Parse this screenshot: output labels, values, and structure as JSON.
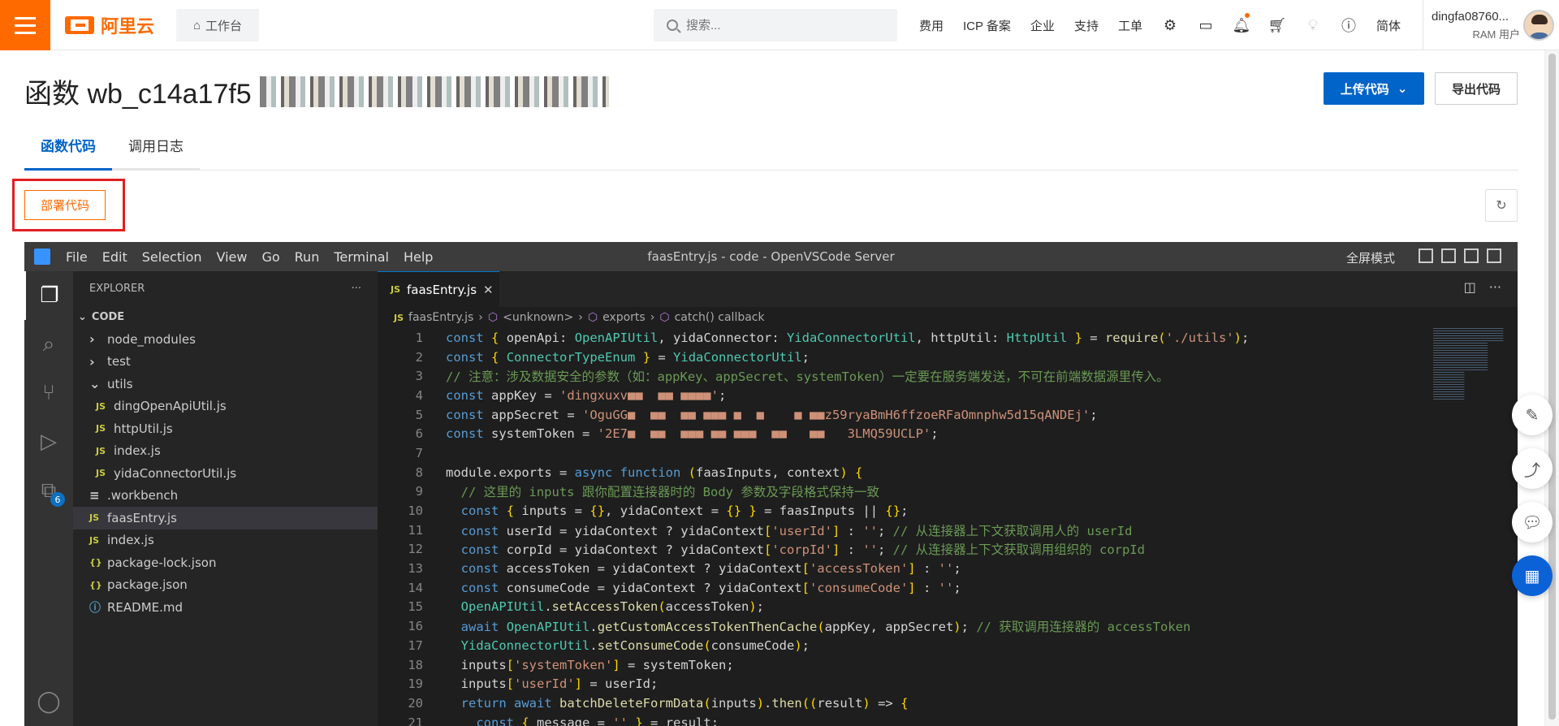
{
  "topbar": {
    "brand": "阿里云",
    "workbench": "工作台",
    "search_placeholder": "搜索...",
    "links": [
      "费用",
      "ICP 备案",
      "企业",
      "支持",
      "工单"
    ],
    "lang": "简体",
    "user_name": "dingfa08760...",
    "user_role": "RAM 用户"
  },
  "page": {
    "title_prefix": "函数 wb_c14a17f5",
    "upload_btn": "上传代码",
    "export_btn": "导出代码",
    "tabs": [
      "函数代码",
      "调用日志"
    ],
    "deploy_btn": "部署代码"
  },
  "vscode": {
    "menu": [
      "File",
      "Edit",
      "Selection",
      "View",
      "Go",
      "Run",
      "Terminal",
      "Help"
    ],
    "window_title": "faasEntry.js - code - OpenVSCode Server",
    "fullscreen": "全屏模式",
    "explorer_title": "EXPLORER",
    "section": "CODE",
    "extensions_badge": "6",
    "tree": [
      {
        "label": "node_modules",
        "type": "folder-closed",
        "indent": 1
      },
      {
        "label": "test",
        "type": "folder-closed",
        "indent": 1
      },
      {
        "label": "utils",
        "type": "folder-open",
        "indent": 1
      },
      {
        "label": "dingOpenApiUtil.js",
        "type": "js",
        "indent": 2
      },
      {
        "label": "httpUtil.js",
        "type": "js",
        "indent": 2
      },
      {
        "label": "index.js",
        "type": "js",
        "indent": 2
      },
      {
        "label": "yidaConnectorUtil.js",
        "type": "js",
        "indent": 2
      },
      {
        "label": ".workbench",
        "type": "text",
        "indent": 1
      },
      {
        "label": "faasEntry.js",
        "type": "js",
        "indent": 1,
        "selected": true
      },
      {
        "label": "index.js",
        "type": "js",
        "indent": 1
      },
      {
        "label": "package-lock.json",
        "type": "json",
        "indent": 1
      },
      {
        "label": "package.json",
        "type": "json",
        "indent": 1
      },
      {
        "label": "README.md",
        "type": "info",
        "indent": 1
      }
    ],
    "tab_label": "faasEntry.js",
    "breadcrumb": [
      "faasEntry.js",
      "<unknown>",
      "exports",
      "catch() callback"
    ],
    "code_lines": [
      "const { openApi: OpenAPIUtil, yidaConnector: YidaConnectorUtil, httpUtil: HttpUtil } = require('./utils');",
      "const { ConnectorTypeEnum } = YidaConnectorUtil;",
      "// 注意：涉及数据安全的参数（如：appKey、appSecret、systemToken）一定要在服务端发送，不可在前端数据源里传入。",
      "const appKey = 'dingxuxv■■  ■■ ■■■■';",
      "const appSecret = 'OguGG■  ■■  ■■ ■■■ ■  ■    ■ ■■z59ryaBmH6ffzoeRFaOmnphw5d15qANDEj';",
      "const systemToken = '2E7■  ■■  ■■■ ■■ ■■■  ■■   ■■   3LMQ59UCLP';",
      "",
      "module.exports = async function (faasInputs, context) {",
      "  // 这里的 inputs 跟你配置连接器时的 Body 参数及字段格式保持一致",
      "  const { inputs = {}, yidaContext = {} } = faasInputs || {};",
      "  const userId = yidaContext ? yidaContext['userId'] : ''; // 从连接器上下文获取调用人的 userId",
      "  const corpId = yidaContext ? yidaContext['corpId'] : ''; // 从连接器上下文获取调用组织的 corpId",
      "  const accessToken = yidaContext ? yidaContext['accessToken'] : '';",
      "  const consumeCode = yidaContext ? yidaContext['consumeCode'] : '';",
      "  OpenAPIUtil.setAccessToken(accessToken);",
      "  await OpenAPIUtil.getCustomAccessTokenThenCache(appKey, appSecret); // 获取调用连接器的 accessToken",
      "  YidaConnectorUtil.setConsumeCode(consumeCode);",
      "  inputs['systemToken'] = systemToken;",
      "  inputs['userId'] = userId;",
      "  return await batchDeleteFormData(inputs).then((result) => {",
      "    const { message = '' } = result;"
    ]
  }
}
